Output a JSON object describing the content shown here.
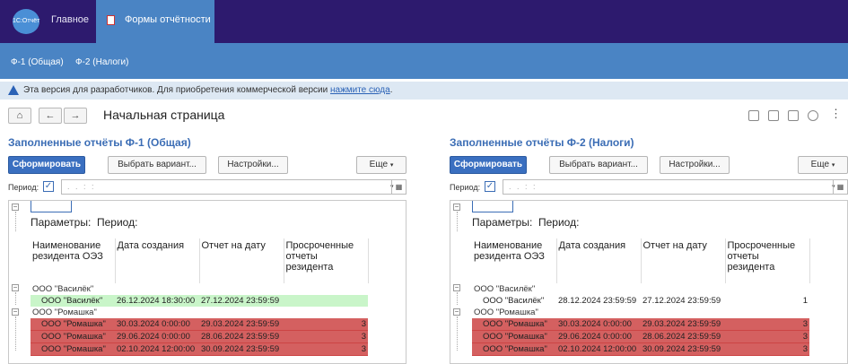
{
  "app": {
    "logo_text": "1С:Отчёт"
  },
  "nav": {
    "home": "Главное",
    "active_tab": "Формы отчётности"
  },
  "subnav": {
    "items": [
      "Ф-1 (Общая)",
      "Ф-2 (Налоги)"
    ]
  },
  "notice": {
    "text": "Эта версия для разработчиков. Для приобретения коммерческой версии ",
    "link": "нажмите сюда",
    "tail": "."
  },
  "header": {
    "title": "Начальная страница",
    "more": "⋮"
  },
  "panels": [
    {
      "title": "Заполненные отчёты Ф-1 (Общая)",
      "buttons": {
        "generate": "Сформировать",
        "variant": "Выбрать вариант...",
        "settings": "Настройки...",
        "more": "Еще"
      },
      "period_label": "Период:",
      "period_value": ". .   : :",
      "params_label": "Параметры:",
      "period_param": "Период:",
      "columns": [
        "Наименование резидента ОЭЗ",
        "Дата создания",
        "Отчет на дату",
        "Просроченные отчеты резидента"
      ],
      "groups": [
        {
          "name": "ООО \"Василёк\"",
          "rows": [
            {
              "name": "ООО \"Василёк\"",
              "created": "26.12.2024 18:30:00",
              "date": "27.12.2024 23:59:59",
              "overdue": "",
              "status": "ok"
            }
          ]
        },
        {
          "name": "ООО \"Ромашка\"",
          "rows": [
            {
              "name": "ООО \"Ромашка\"",
              "created": "30.03.2024 0:00:00",
              "date": "29.03.2024 23:59:59",
              "overdue": "3",
              "status": "bad"
            },
            {
              "name": "ООО \"Ромашка\"",
              "created": "29.06.2024 0:00:00",
              "date": "28.06.2024 23:59:59",
              "overdue": "3",
              "status": "bad"
            },
            {
              "name": "ООО \"Ромашка\"",
              "created": "02.10.2024 12:00:00",
              "date": "30.09.2024 23:59:59",
              "overdue": "3",
              "status": "bad"
            }
          ]
        }
      ]
    },
    {
      "title": "Заполненные отчёты Ф-2 (Налоги)",
      "buttons": {
        "generate": "Сформировать",
        "variant": "Выбрать вариант...",
        "settings": "Настройки...",
        "more": "Еще"
      },
      "period_label": "Период:",
      "period_value": ". .   : :",
      "params_label": "Параметры:",
      "period_param": "Период:",
      "columns": [
        "Наименование резидента ОЭЗ",
        "Дата создания",
        "Отчет на дату",
        "Просроченные отчеты резидента"
      ],
      "groups": [
        {
          "name": "ООО \"Василёк\"",
          "rows": [
            {
              "name": "ООО \"Василёк\"",
              "created": "28.12.2024 23:59:59",
              "date": "27.12.2024 23:59:59",
              "overdue": "1",
              "status": "plain"
            }
          ]
        },
        {
          "name": "ООО \"Ромашка\"",
          "rows": [
            {
              "name": "ООО \"Ромашка\"",
              "created": "30.03.2024 0:00:00",
              "date": "29.03.2024 23:59:59",
              "overdue": "3",
              "status": "bad"
            },
            {
              "name": "ООО \"Ромашка\"",
              "created": "29.06.2024 0:00:00",
              "date": "28.06.2024 23:59:59",
              "overdue": "3",
              "status": "bad"
            },
            {
              "name": "ООО \"Ромашка\"",
              "created": "02.10.2024 12:00:00",
              "date": "30.09.2024 23:59:59",
              "overdue": "3",
              "status": "bad"
            }
          ]
        }
      ]
    }
  ]
}
